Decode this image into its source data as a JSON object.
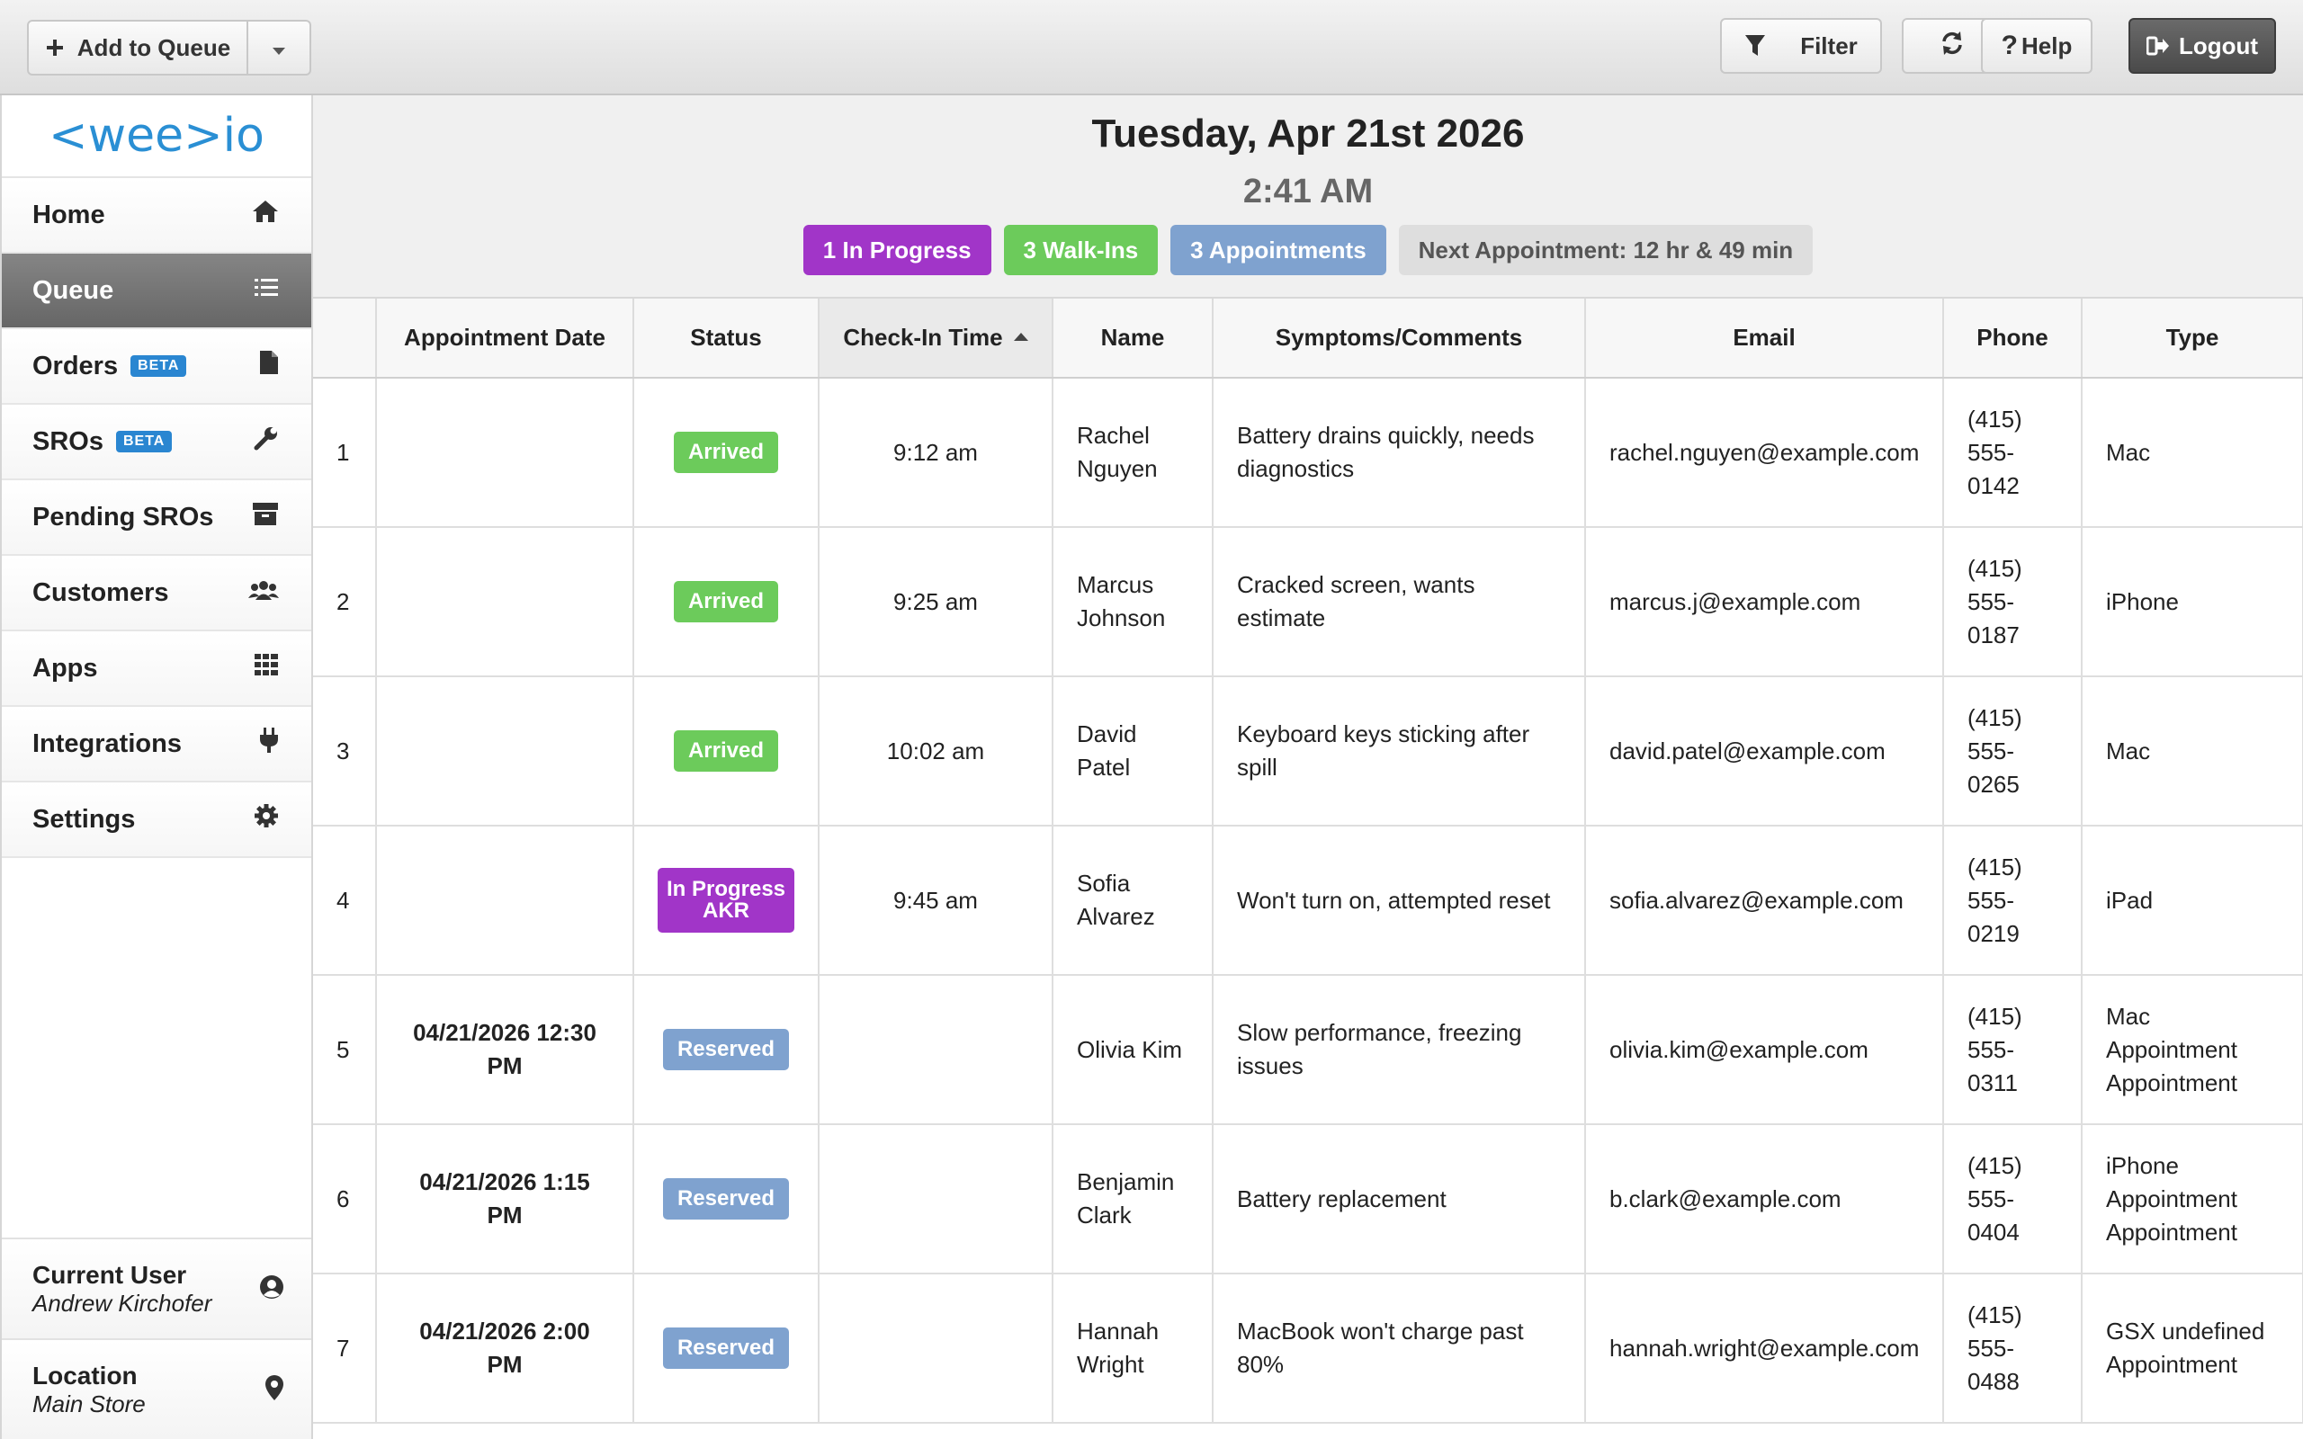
{
  "toolbar": {
    "add_to_queue": "Add to Queue",
    "filter": "Filter",
    "help": "Help",
    "logout": "Logout"
  },
  "sidebar": {
    "logo_text": "<wee>io",
    "items": [
      {
        "label": "Home",
        "icon": "home-icon"
      },
      {
        "label": "Queue",
        "icon": "list-icon",
        "active": true
      },
      {
        "label": "Orders",
        "badge": "BETA",
        "icon": "file-icon"
      },
      {
        "label": "SROs",
        "badge": "BETA",
        "icon": "wrench-icon"
      },
      {
        "label": "Pending SROs",
        "icon": "box-icon"
      },
      {
        "label": "Customers",
        "icon": "users-icon"
      },
      {
        "label": "Apps",
        "icon": "grid-icon"
      },
      {
        "label": "Integrations",
        "icon": "plug-icon"
      },
      {
        "label": "Settings",
        "icon": "gear-icon"
      }
    ],
    "current_user_label": "Current User",
    "current_user": "Andrew Kirchofer",
    "location_label": "Location",
    "location": "Main Store"
  },
  "header": {
    "date": "Tuesday, Apr 21st 2026",
    "time": "2:41 AM",
    "badges": {
      "in_progress": "1 In Progress",
      "walk_ins": "3 Walk-Ins",
      "appointments": "3 Appointments",
      "next_appointment": "Next Appointment: 12 hr & 49 min"
    }
  },
  "colors": {
    "in_progress": "#a135c8",
    "walk_ins": "#6ccb5b",
    "appointments": "#7fa2cf",
    "next": "#dedede",
    "logo": "#2a8fd4"
  },
  "table": {
    "columns": [
      "",
      "Appointment Date",
      "Status",
      "Check-In Time",
      "Name",
      "Symptoms/Comments",
      "Email",
      "Phone",
      "Type"
    ],
    "rows": [
      {
        "num": "1",
        "appt": "",
        "status": "Arrived",
        "status_kind": "arrived",
        "checkin": "9:12 am",
        "name": "Rachel Nguyen",
        "comments": "Battery drains quickly, needs diagnostics",
        "email": "rachel.nguyen@example.com",
        "phone": "(415) 555-0142",
        "type": "Mac"
      },
      {
        "num": "2",
        "appt": "",
        "status": "Arrived",
        "status_kind": "arrived",
        "checkin": "9:25 am",
        "name": "Marcus Johnson",
        "comments": "Cracked screen, wants estimate",
        "email": "marcus.j@example.com",
        "phone": "(415) 555-0187",
        "type": "iPhone"
      },
      {
        "num": "3",
        "appt": "",
        "status": "Arrived",
        "status_kind": "arrived",
        "checkin": "10:02 am",
        "name": "David Patel",
        "comments": "Keyboard keys sticking after spill",
        "email": "david.patel@example.com",
        "phone": "(415) 555-0265",
        "type": "Mac"
      },
      {
        "num": "4",
        "appt": "",
        "status": "In Progress AKR",
        "status_kind": "inprog",
        "checkin": "9:45 am",
        "name": "Sofia Alvarez",
        "comments": "Won't turn on, attempted reset",
        "email": "sofia.alvarez@example.com",
        "phone": "(415) 555-0219",
        "type": "iPad"
      },
      {
        "num": "5",
        "appt": "04/21/2026 12:30 PM",
        "status": "Reserved",
        "status_kind": "reserved",
        "checkin": "",
        "name": "Olivia Kim",
        "comments": "Slow performance, freezing issues",
        "email": "olivia.kim@example.com",
        "phone": "(415) 555-0311",
        "type": "Mac Appointment Appointment"
      },
      {
        "num": "6",
        "appt": "04/21/2026 1:15 PM",
        "status": "Reserved",
        "status_kind": "reserved",
        "checkin": "",
        "name": "Benjamin Clark",
        "comments": "Battery replacement",
        "email": "b.clark@example.com",
        "phone": "(415) 555-0404",
        "type": "iPhone Appointment Appointment"
      },
      {
        "num": "7",
        "appt": "04/21/2026 2:00 PM",
        "status": "Reserved",
        "status_kind": "reserved",
        "checkin": "",
        "name": "Hannah Wright",
        "comments": "MacBook won't charge past 80%",
        "email": "hannah.wright@example.com",
        "phone": "(415) 555-0488",
        "type": "GSX undefined Appointment"
      }
    ]
  }
}
